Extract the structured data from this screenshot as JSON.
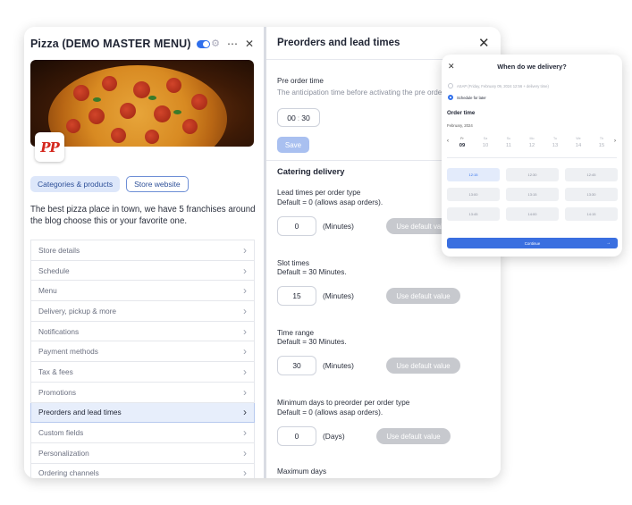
{
  "store": {
    "title": "Pizza (DEMO MASTER MENU)",
    "logo_text": "PP",
    "buttons": {
      "categories": "Categories & products",
      "website": "Store website"
    },
    "description": "The best pizza place in town, we have 5 franchises around the blog choose this or your favorite one."
  },
  "menu": {
    "items": [
      "Store details",
      "Schedule",
      "Menu",
      "Delivery, pickup & more",
      "Notifications",
      "Payment methods",
      "Tax & fees",
      "Promotions",
      "Preorders and lead times",
      "Custom fields",
      "Personalization",
      "Ordering channels"
    ],
    "active": "Preorders and lead times"
  },
  "panel": {
    "title": "Preorders and lead times",
    "pre_order": {
      "label": "Pre order time",
      "hint": "The anticipation time before activating the pre orders.",
      "hours": "00",
      "minutes": "30",
      "save": "Save"
    },
    "catering_title": "Catering delivery",
    "lead": {
      "label": "Lead times per order type",
      "default": "Default = 0 (allows asap orders).",
      "value": "0",
      "unit": "(Minutes)",
      "button": "Use default value"
    },
    "slot": {
      "label": "Slot times",
      "default": "Default = 30 Minutes.",
      "value": "15",
      "unit": "(Minutes)",
      "button": "Use default value"
    },
    "range": {
      "label": "Time range",
      "default": "Default = 30 Minutes.",
      "value": "30",
      "unit": "(Minutes)",
      "button": "Use default value"
    },
    "min_days": {
      "label": "Minimum days to preorder per order type",
      "default": "Default = 0 (allows asap orders).",
      "value": "0",
      "unit": "(Days)",
      "button": "Use default value"
    },
    "max_days": {
      "label": "Maximum days"
    }
  },
  "popup": {
    "title": "When do we delivery?",
    "asap": "ASAP (Friday, February 09, 2024 12:56 + delivery time)",
    "schedule": "Schedule for later",
    "order_time": "Order time",
    "month": "February, 2024",
    "days": [
      {
        "name": "Fr",
        "date": "09"
      },
      {
        "name": "Sa",
        "date": "10"
      },
      {
        "name": "Su",
        "date": "11"
      },
      {
        "name": "Mo",
        "date": "12"
      },
      {
        "name": "Tu",
        "date": "13"
      },
      {
        "name": "We",
        "date": "14"
      },
      {
        "name": "Th",
        "date": "15"
      }
    ],
    "slots": [
      "12:15",
      "12:30",
      "12:45",
      "13:00",
      "13:15",
      "13:30",
      "13:45",
      "14:00",
      "14:15"
    ],
    "selected_slot": "12:15",
    "continue": "Continue"
  },
  "colors": {
    "accent": "#2f6fec",
    "active_row": "#e7eefb",
    "disabled_button": "#c7c9ce"
  }
}
